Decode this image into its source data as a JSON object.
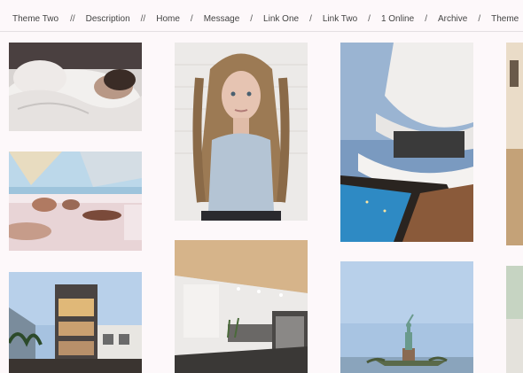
{
  "nav": {
    "items": [
      {
        "label": "Theme Two"
      },
      {
        "label": "Description"
      },
      {
        "label": "Home"
      },
      {
        "label": "Message"
      },
      {
        "label": "Link One"
      },
      {
        "label": "Link Two"
      },
      {
        "label": "1 Online"
      },
      {
        "label": "Archive"
      },
      {
        "label": "Theme"
      }
    ],
    "separators": [
      "//",
      "//",
      "/",
      "/",
      "/",
      "/",
      "/",
      "/"
    ]
  },
  "photos": [
    {
      "subject": "person sleeping in bed"
    },
    {
      "subject": "people lounging on yacht deck"
    },
    {
      "subject": "modern house exterior at dusk"
    },
    {
      "subject": "portrait of woman with long hair"
    },
    {
      "subject": "modern kitchen interior"
    },
    {
      "subject": "statue of liberty"
    },
    {
      "subject": "modern villa exterior"
    },
    {
      "subject": "interior partial"
    }
  ]
}
